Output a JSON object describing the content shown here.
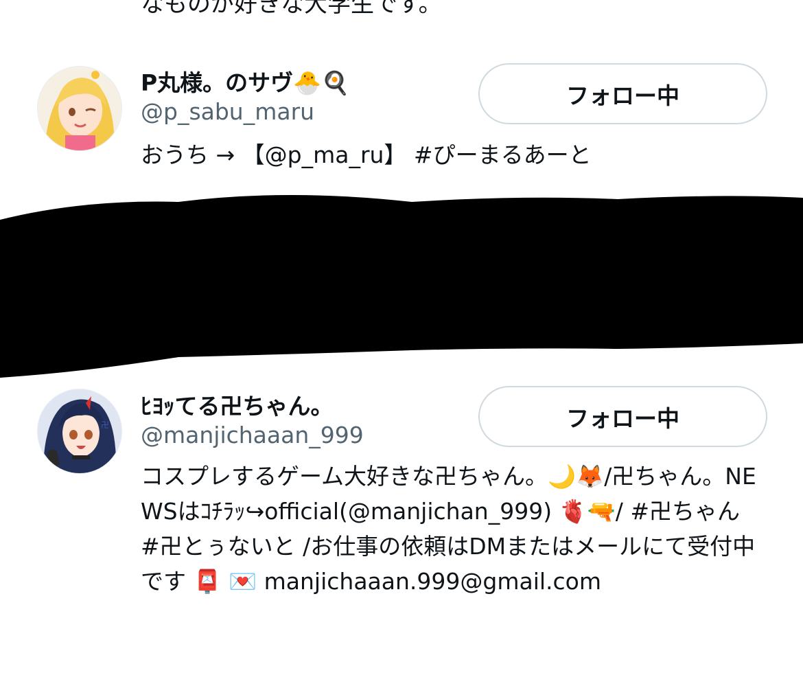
{
  "top_fragment": {
    "text": "なものが好きな大学生です。"
  },
  "users": [
    {
      "display_name": "P丸様。のサヴ🐣🍳",
      "handle": "@p_sabu_maru",
      "bio": "おうち → 【@p_ma_ru】 #ぴーまるあーと",
      "follow_label": "フォロー中",
      "avatar_icon": "anime-avatar-blonde"
    },
    {
      "display_name": "ﾋﾖｯてる卍ちゃん。",
      "handle": "@manjichaaan_999",
      "bio": "コスプレするゲーム大好きな卍ちゃん。🌙🦊/卍ちゃん。NEWSはｺﾁﾗｯ↪official(@manjichan_999) 🫀🔫/ #卍ちゃん #卍とぅないと /お仕事の依頼はDMまたはメールにて受付中です 📮 💌 manjichaaan.999@gmail.com",
      "follow_label": "フォロー中",
      "avatar_icon": "anime-avatar-dark-hair"
    }
  ],
  "colors": {
    "text_primary": "#0f1419",
    "text_secondary": "#536471",
    "button_border": "#cfd9de",
    "redaction": "#000000"
  }
}
